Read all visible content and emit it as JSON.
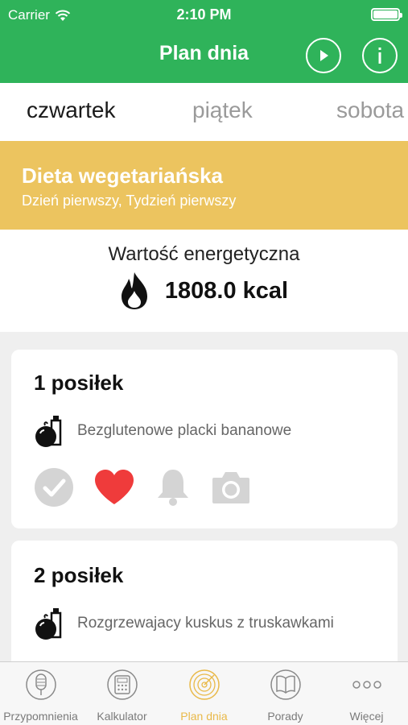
{
  "status_bar": {
    "carrier": "Carrier",
    "time": "2:10 PM"
  },
  "nav": {
    "title": "Plan dnia",
    "play_icon": "play-circle-icon",
    "info_icon": "info-circle-icon"
  },
  "days": [
    "czwartek",
    "piątek",
    "sobota"
  ],
  "diet": {
    "title": "Dieta wegetariańska",
    "subtitle": "Dzień pierwszy, Tydzień pierwszy"
  },
  "energy": {
    "label": "Wartość energetyczna",
    "value": "1808.0 kcal",
    "icon": "flame-icon"
  },
  "meals": [
    {
      "title": "1 posiłek",
      "dish": "Bezglutenowe placki bananowe",
      "favorite": true
    },
    {
      "title": "2 posiłek",
      "dish": "Rozgrzewajacy kuskus z truskawkami"
    }
  ],
  "tabbar": {
    "items": [
      {
        "label": "Przypomnienia",
        "icon": "microphone-icon"
      },
      {
        "label": "Kalkulator",
        "icon": "calculator-icon"
      },
      {
        "label": "Plan dnia",
        "icon": "target-icon",
        "active": true
      },
      {
        "label": "Porady",
        "icon": "book-icon"
      },
      {
        "label": "Więcej",
        "icon": "more-dots-icon"
      }
    ]
  },
  "colors": {
    "header": "#2fb35a",
    "diet_banner": "#ecc45f",
    "heart": "#ef3b3b",
    "active_tab": "#e9b949"
  }
}
